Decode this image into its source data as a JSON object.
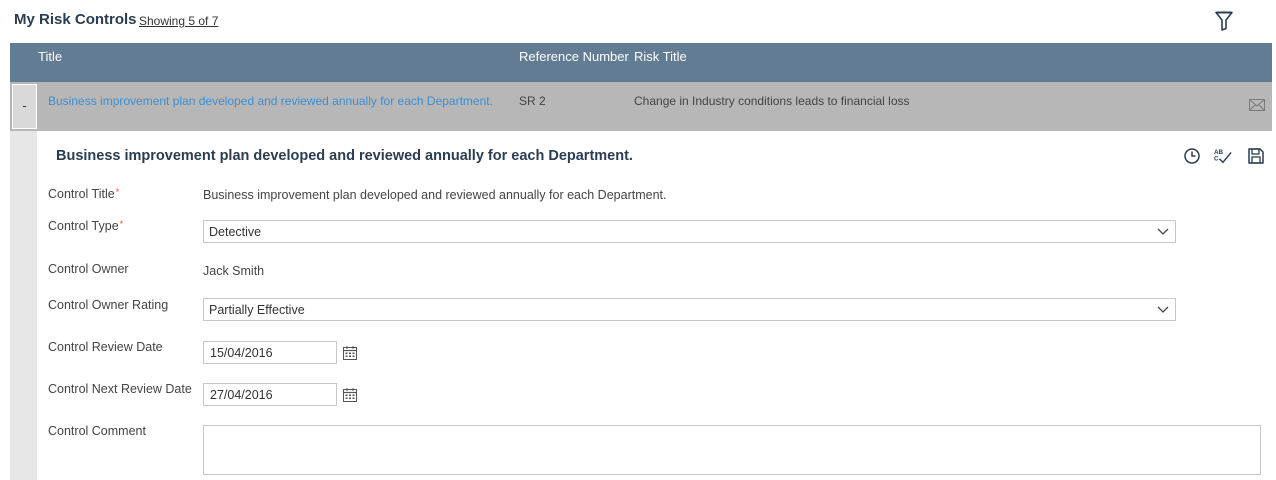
{
  "header": {
    "title": "My Risk Controls",
    "showing": "Showing 5 of 7",
    "filter_icon": "filter-icon"
  },
  "grid": {
    "columns": [
      "Title",
      "Reference Number",
      "Risk Title"
    ],
    "row": {
      "toggle": "-",
      "title": "Business improvement plan developed and reviewed annually for each Department.",
      "reference": "SR 2",
      "risk_title": "Change in Industry conditions leads to financial loss",
      "action_icon": "mail-icon"
    }
  },
  "detail": {
    "title": "Business improvement plan developed and reviewed annually for each Department.",
    "toolbar_icons": [
      "history-icon",
      "spellcheck-icon",
      "save-icon"
    ],
    "required_marker": "*",
    "fields": {
      "control_title": {
        "label": "Control Title",
        "value": "Business improvement plan developed and reviewed annually for each Department."
      },
      "control_type": {
        "label": "Control Type",
        "value": "Detective"
      },
      "control_owner": {
        "label": "Control Owner",
        "value": "Jack Smith"
      },
      "control_owner_rating": {
        "label": "Control Owner Rating",
        "value": "Partially Effective"
      },
      "control_review_date": {
        "label": "Control Review Date",
        "value": "15/04/2016"
      },
      "control_next_review_date": {
        "label": "Control Next Review Date",
        "value": "27/04/2016"
      },
      "control_comment": {
        "label": "Control Comment",
        "value": ""
      }
    }
  },
  "colors": {
    "header_bar": "#627d93",
    "row_bg": "#b7b7b7",
    "link": "#3d8fd1",
    "title_text": "#2b3e50",
    "required": "#d9534f"
  }
}
